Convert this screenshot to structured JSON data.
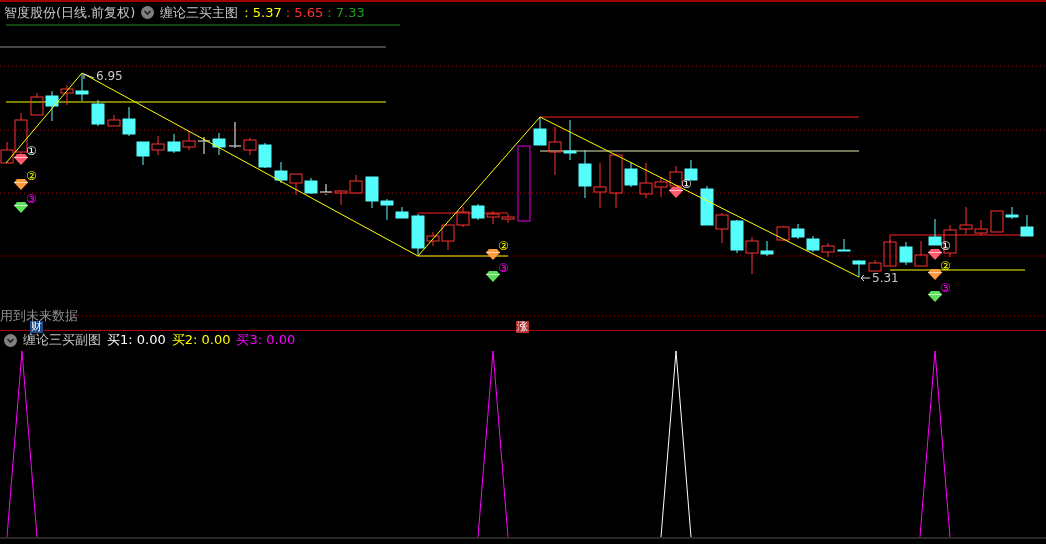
{
  "header": {
    "title": "智度股份(日线.前复权)",
    "indicator": "缠论三买主图",
    "values": [
      {
        "text": ": 5.37",
        "color": "#ffff00"
      },
      {
        "text": ": 5.65",
        "color": "#ff3232"
      },
      {
        "text": ": 7.33",
        "color": "#1ea01e"
      }
    ]
  },
  "main_chart": {
    "price_labels": [
      {
        "kind": "high",
        "text": "6.95"
      },
      {
        "kind": "low",
        "text": "5.31"
      }
    ],
    "signals": [
      {
        "kind": "buy1",
        "label": "①"
      },
      {
        "kind": "buy2",
        "label": "②"
      },
      {
        "kind": "buy3",
        "label": "③"
      },
      {
        "kind": "buy2",
        "label": "②"
      },
      {
        "kind": "buy3",
        "label": "③"
      },
      {
        "kind": "buy1",
        "label": "①"
      },
      {
        "kind": "buy1",
        "label": "①"
      },
      {
        "kind": "buy2",
        "label": "②"
      },
      {
        "kind": "buy3",
        "label": "③"
      }
    ],
    "warning": "用到未来数据",
    "badges": [
      {
        "kind": "finance",
        "text": "财"
      },
      {
        "kind": "rise",
        "text": "涨"
      }
    ]
  },
  "sub_chart": {
    "title": "缠论三买副图",
    "legend": [
      {
        "label": "买1: 0.00",
        "color": "#ffffff"
      },
      {
        "label": "买2: 0.00",
        "color": "#ffff00"
      },
      {
        "label": "买3: 0.00",
        "color": "#ff00ff"
      }
    ]
  }
}
